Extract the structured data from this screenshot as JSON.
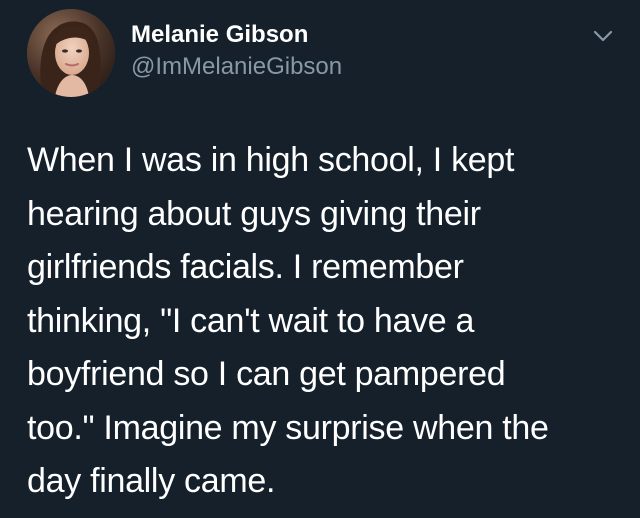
{
  "author": {
    "display_name": "Melanie Gibson",
    "handle": "@ImMelanieGibson",
    "avatar_icon": "user-avatar"
  },
  "tweet": {
    "lines": [
      "When I was in high school, I kept",
      "hearing about guys giving their",
      "girlfriends facials. I remember",
      "thinking, \"I can't wait to have a",
      "boyfriend so I can get pampered",
      "too.\" Imagine my surprise when the",
      "day finally came."
    ]
  },
  "menu": {
    "icon": "chevron-down-icon"
  },
  "colors": {
    "background": "#15202b",
    "primary_text": "#ffffff",
    "secondary_text": "#8899a6",
    "icon": "#8899a6"
  }
}
